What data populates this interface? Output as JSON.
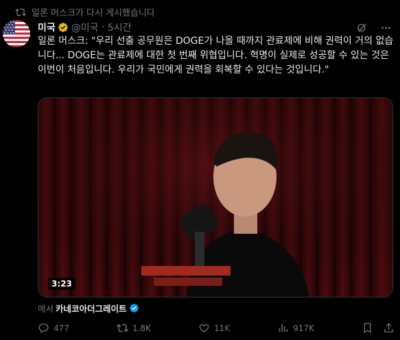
{
  "repost": {
    "text": "일론 머스크가 다시 게시했습니다"
  },
  "author": {
    "name": "미국",
    "handle": "@미국",
    "time": "5시간"
  },
  "tweet": {
    "text": "일론 머스크: \"우리 선출 공무원은 DOGE가 나올 때까지 관료제에 비해 권력이 거의 없습니다... DOGE는 관료제에 대한 첫 번째 위협입니다. 혁명이 실제로 성공할 수 있는 것은 이번이 처음입니다. 우리가 국민에게 권력을 회복할 수 있다는 것입니다.\""
  },
  "video": {
    "duration": "3:23"
  },
  "source": {
    "from": "에서",
    "account": "카네코아더그레이트"
  },
  "actions": {
    "replies": "477",
    "reposts": "1.8K",
    "likes": "11K",
    "views": "917K"
  },
  "colors": {
    "background": "#000000",
    "muted": "#71767b",
    "verified": "#1d9bf0",
    "gold_badge": "#e2b719"
  }
}
